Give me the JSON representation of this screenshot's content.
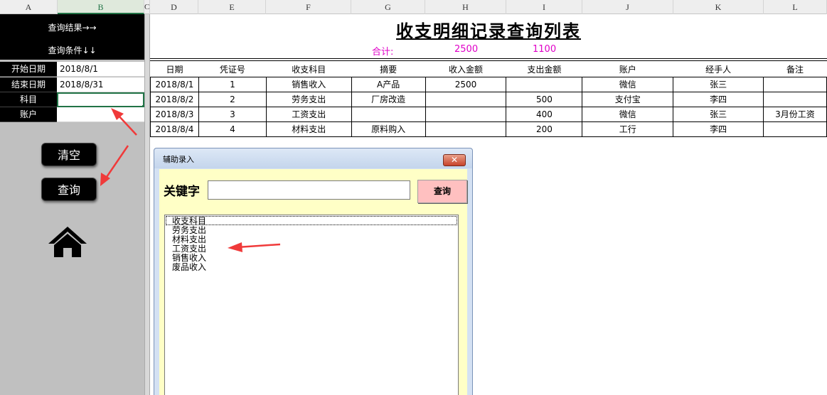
{
  "columns": [
    "A",
    "B",
    "C",
    "D",
    "E",
    "F",
    "G",
    "H",
    "I",
    "J",
    "K",
    "L"
  ],
  "left_panel": {
    "query_result_label": "查询结果→→",
    "query_condition_label": "查询条件↓↓",
    "rows": [
      {
        "label": "开始日期",
        "value": "2018/8/1"
      },
      {
        "label": "结束日期",
        "value": "2018/8/31"
      },
      {
        "label": "科目",
        "value": ""
      },
      {
        "label": "账户",
        "value": ""
      }
    ],
    "clear_button": "清空",
    "query_button": "查询",
    "home_icon": "home-icon"
  },
  "sheet": {
    "title": "收支明细记录查询列表",
    "totals": {
      "label": "合计:",
      "income": "2500",
      "expense": "1100"
    },
    "headers": [
      "日期",
      "凭证号",
      "收支科目",
      "摘要",
      "收入金额",
      "支出金额",
      "账户",
      "经手人",
      "备注"
    ],
    "rows": [
      [
        "2018/8/1",
        "1",
        "销售收入",
        "A产品",
        "2500",
        "",
        "微信",
        "张三",
        ""
      ],
      [
        "2018/8/2",
        "2",
        "劳务支出",
        "厂房改造",
        "",
        "500",
        "支付宝",
        "李四",
        ""
      ],
      [
        "2018/8/3",
        "3",
        "工资支出",
        "",
        "",
        "400",
        "微信",
        "张三",
        "3月份工资"
      ],
      [
        "2018/8/4",
        "4",
        "材料支出",
        "原料购入",
        "",
        "200",
        "工行",
        "李四",
        ""
      ]
    ]
  },
  "dialog": {
    "title": "辅助录入",
    "keyword_label": "关键字",
    "keyword_value": "",
    "query_button": "查询",
    "close_icon": "close-icon",
    "list_items": [
      "收支科目",
      "劳务支出",
      "材料支出",
      "工资支出",
      "销售收入",
      "废品收入"
    ]
  },
  "colors": {
    "accent_green": "#217346",
    "totals_magenta": "#e000c8",
    "arrow_red": "#f03a3a",
    "dialog_body": "#ffffc6"
  }
}
